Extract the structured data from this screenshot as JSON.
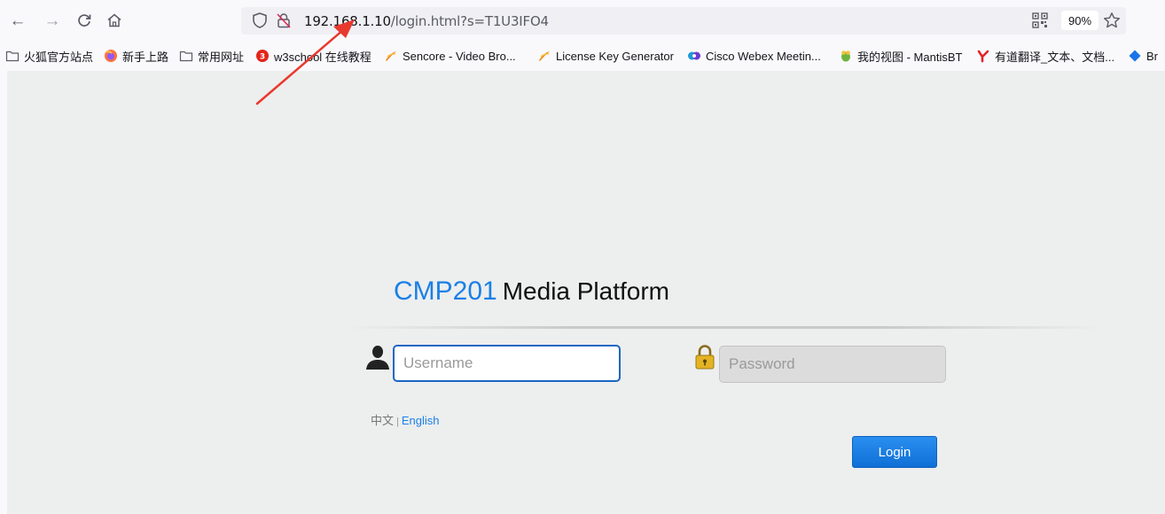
{
  "browser": {
    "url": {
      "host": "192.168.1.10",
      "path": "/login.html?s=T1U3IFO4"
    },
    "zoom": "90%",
    "bookmarks": [
      {
        "label": "火狐官方站点",
        "icon": "folder-icon"
      },
      {
        "label": "新手上路",
        "icon": "firefox-icon"
      },
      {
        "label": "常用网址",
        "icon": "folder-icon"
      },
      {
        "label": "w3school 在线教程",
        "icon": "w3school-icon"
      },
      {
        "label": "Sencore - Video Bro...",
        "icon": "sencore-icon"
      },
      {
        "label": "License Key Generator",
        "icon": "sencore-icon"
      },
      {
        "label": "Cisco Webex Meetin...",
        "icon": "webex-icon"
      },
      {
        "label": "我的视图 - MantisBT",
        "icon": "mantis-icon"
      },
      {
        "label": "有道翻译_文本、文档...",
        "icon": "youdao-icon"
      },
      {
        "label": "Br",
        "icon": "diamond-icon"
      }
    ]
  },
  "page": {
    "brand": {
      "code": "CMP201",
      "rest": "Media Platform"
    },
    "username_placeholder": "Username",
    "password_placeholder": "Password",
    "lang": {
      "zh": "中文",
      "separator": "|",
      "en": "English"
    },
    "login_label": "Login"
  },
  "colors": {
    "brand_blue": "#1a80e6",
    "button_blue": "#1a7be0",
    "annotation_arrow": "#e8392e"
  }
}
